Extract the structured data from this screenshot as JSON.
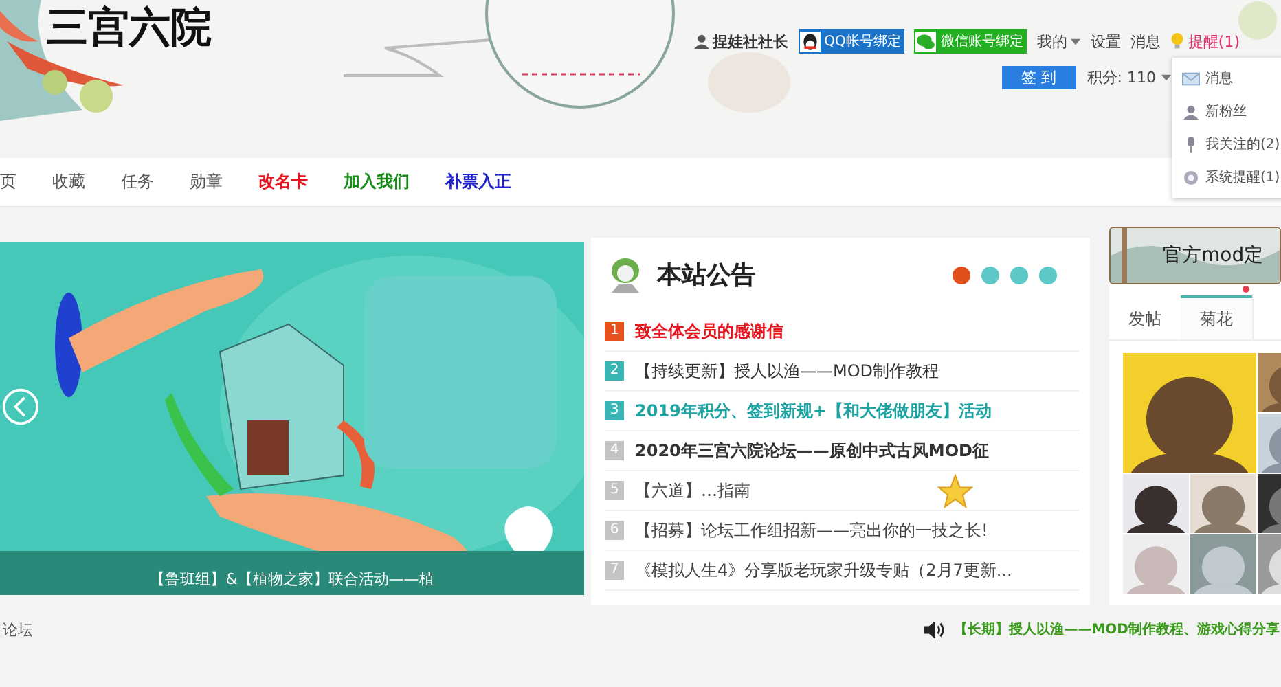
{
  "header": {
    "logo": "三宫六院",
    "user": {
      "name": "捏娃社社长"
    },
    "bind_buttons": [
      {
        "kind": "qq",
        "label": "QQ帐号绑定"
      },
      {
        "kind": "wechat",
        "label": "微信账号绑定"
      }
    ],
    "links": [
      {
        "label": "我的",
        "dropdown": true
      },
      {
        "label": "设置",
        "dropdown": false
      },
      {
        "label": "消息",
        "dropdown": false
      }
    ],
    "reminder": "提醒(1)",
    "checkin_button": "签 到",
    "points": "积分: 110",
    "menu": [
      {
        "kind": "mail",
        "label": "消息"
      },
      {
        "kind": "person",
        "label": "新粉丝"
      },
      {
        "kind": "pin",
        "label": "我关注的(2)"
      },
      {
        "kind": "system",
        "label": "系统提醒(1)"
      }
    ]
  },
  "nav": [
    {
      "label": "页",
      "color": "#555555"
    },
    {
      "label": "收藏",
      "color": "#555555"
    },
    {
      "label": "任务",
      "color": "#555555"
    },
    {
      "label": "勋章",
      "color": "#555555"
    },
    {
      "label": "改名卡",
      "color": "#e8141e"
    },
    {
      "label": "加入我们",
      "color": "#1a8a1a"
    },
    {
      "label": "补票入正",
      "color": "#2222cc"
    }
  ],
  "slider": {
    "caption": "【鲁班组】&【植物之家】联合活动——植"
  },
  "notice": {
    "title": "本站公告",
    "pager": [
      {
        "selected": true
      },
      {
        "selected": false
      },
      {
        "selected": false
      },
      {
        "selected": false
      }
    ],
    "items": [
      {
        "num": "1",
        "color": "#e8501e",
        "kind": "alert",
        "text": "致全体会员的感谢信",
        "starred": false
      },
      {
        "num": "2",
        "color": "#3bb4b4",
        "kind": "plain",
        "text": "【持续更新】授人以渔——MOD制作教程",
        "starred": false
      },
      {
        "num": "3",
        "color": "#3bb4b4",
        "kind": "accent",
        "text": "2019年积分、签到新规+【和大佬做朋友】活动",
        "starred": false
      },
      {
        "num": "4",
        "color": "#c4c4c4",
        "kind": "bold",
        "text": "2020年三宫六院论坛——原创中式古风MOD征",
        "starred": false
      },
      {
        "num": "5",
        "color": "#c4c4c4",
        "kind": "faint",
        "text": "【六道】…指南",
        "starred": true
      },
      {
        "num": "6",
        "color": "#c4c4c4",
        "kind": "faint",
        "text": "【招募】论坛工作组招新——亮出你的一技之长!",
        "starred": false
      },
      {
        "num": "7",
        "color": "#c4c4c4",
        "kind": "faint",
        "text": "《模拟人生4》分享版老玩家升级专贴（2月7更新...",
        "starred": false
      }
    ]
  },
  "side": {
    "banner": "官方mod定",
    "tabs": [
      {
        "label": "发帖",
        "selected": false
      },
      {
        "label": "菊花",
        "selected": true
      }
    ]
  },
  "footer": {
    "breadcrumb": "论坛",
    "ticker": "【长期】授人以渔——MOD制作教程、游戏心得分享"
  }
}
